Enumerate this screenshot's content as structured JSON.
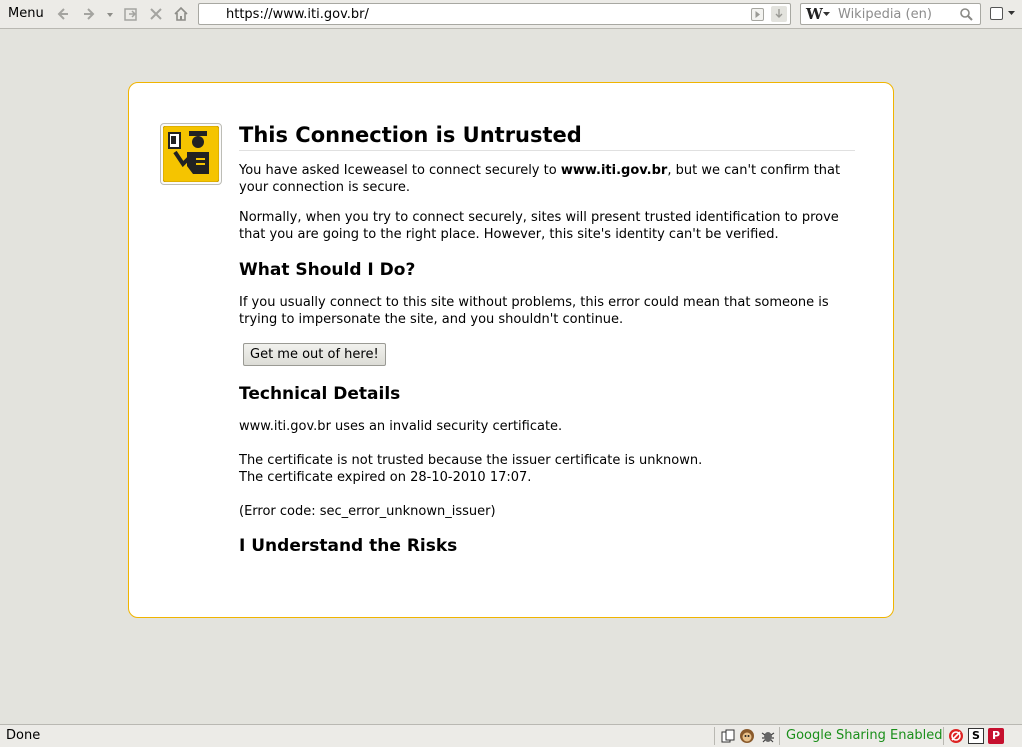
{
  "toolbar": {
    "menu_label": "Menu",
    "url": "https://www.iti.gov.br/",
    "search_placeholder": "Wikipedia (en)",
    "search_engine_glyph": "W"
  },
  "error_page": {
    "title": "This Connection is Untrusted",
    "intro_before": "You have asked Iceweasel to connect securely to ",
    "intro_host": "www.iti.gov.br",
    "intro_after": ", but we can't confirm that your connection is secure.",
    "normally": "Normally, when you try to connect securely, sites will present trusted identification to prove that you are going to the right place. However, this site's identity can't be verified.",
    "what_heading": "What Should I Do?",
    "what_text": "If you usually connect to this site without problems, this error could mean that someone is trying to impersonate the site, and you shouldn't continue.",
    "get_out_button": "Get me out of here!",
    "tech_heading": "Technical Details",
    "tech_invalid": "www.iti.gov.br uses an invalid security certificate.",
    "tech_not_trusted": "The certificate is not trusted because the issuer certificate is unknown.",
    "tech_expired": "The certificate expired on 28-10-2010 17:07.",
    "tech_error_code": "(Error code: sec_error_unknown_issuer)",
    "risks_heading": "I Understand the Risks"
  },
  "statusbar": {
    "status": "Done",
    "sharing_label": "Google Sharing Enabled",
    "s_badge": "S",
    "p_badge": "P"
  },
  "colors": {
    "box_border": "#f0b400",
    "sharing_text": "#1a8f1a",
    "icon_yellow": "#f5c400"
  },
  "icons": [
    "back-icon",
    "forward-icon",
    "history-dropdown-icon",
    "page-icon",
    "stop-icon",
    "home-icon",
    "go-icon",
    "dropmarker-icon",
    "wikipedia-icon",
    "search-icon",
    "certificate-officer-icon",
    "clipboard-icon",
    "monkey-icon",
    "bug-icon",
    "noscript-icon"
  ]
}
